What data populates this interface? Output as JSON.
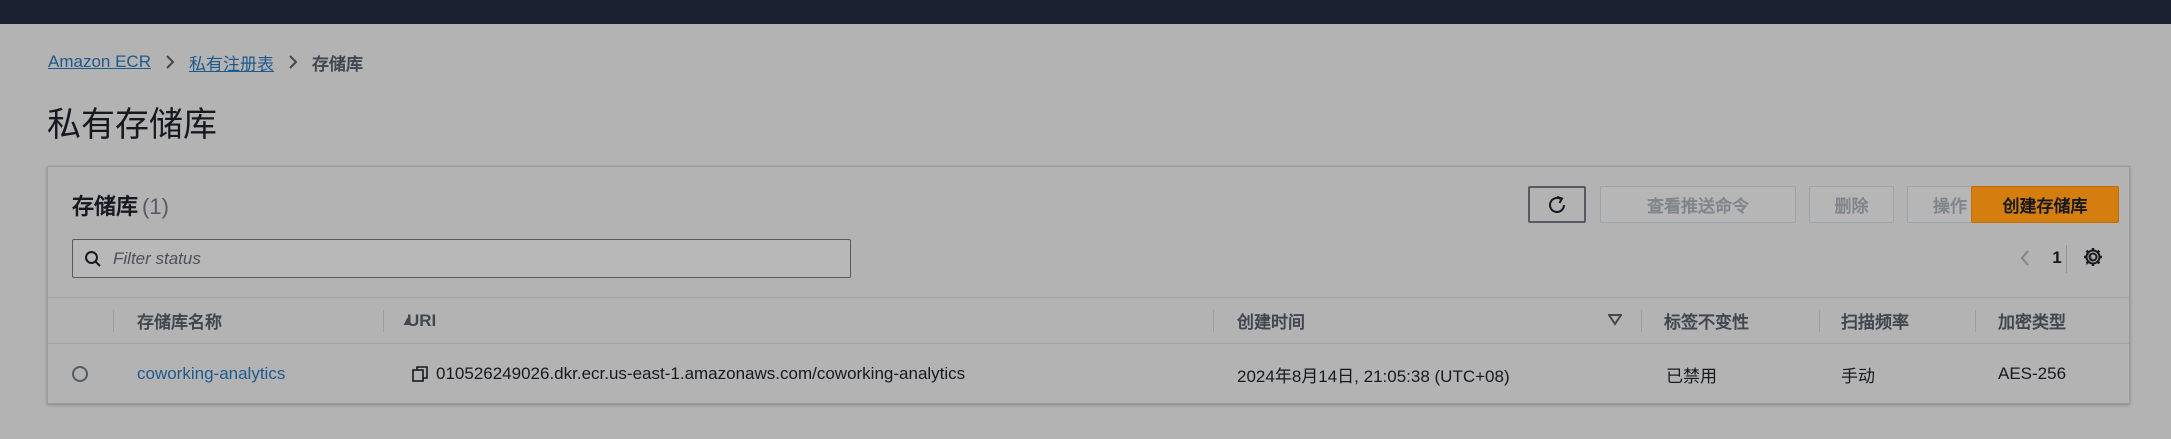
{
  "breadcrumb": {
    "items": [
      "Amazon ECR",
      "私有注册表"
    ],
    "current": "存储库"
  },
  "page": {
    "title": "私有存储库"
  },
  "panel": {
    "title": "存储库",
    "count": "(1)",
    "buttons": {
      "push": "查看推送命令",
      "delete": "删除",
      "actions": "操作",
      "create": "创建存储库"
    },
    "search": {
      "placeholder": "Filter status",
      "value": ""
    },
    "pagination": {
      "current_page": "1"
    }
  },
  "table": {
    "columns": [
      "存储库名称",
      "URI",
      "创建时间",
      "标签不变性",
      "扫描频率",
      "加密类型"
    ],
    "sort": {
      "column": "存储库名称",
      "direction": "ascending"
    },
    "rows": [
      {
        "name": "coworking-analytics",
        "uri": "010526249026.dkr.ecr.us-east-1.amazonaws.com/coworking-analytics",
        "created": "2024年8月14日, 21:05:38 (UTC+08)",
        "tag_immutability": "已禁用",
        "scan_frequency": "手动",
        "encryption": "AES-256"
      }
    ]
  },
  "colors": {
    "topbar": "#1b2130",
    "link": "#1f5a8c",
    "primary_button": "#d47e0f",
    "overlay_background": "#b3b3b3"
  }
}
